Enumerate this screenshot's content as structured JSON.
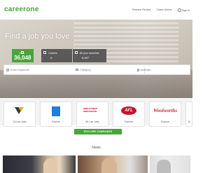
{
  "header": {
    "logo": "careerone",
    "nav": [
      "Resume Review",
      "Career Advice",
      "Sign In"
    ]
  },
  "hero": {
    "title": "Find a job you love",
    "stats": [
      {
        "label": "Jobs",
        "value": "36,048"
      },
      {
        "label": "Careers",
        "value": "5"
      },
      {
        "label": "All your searches",
        "value": "5,467"
      }
    ]
  },
  "search": {
    "keyword_placeholder": "Enter Keywords",
    "category_placeholder": "Category",
    "location_placeholder": "Australia"
  },
  "companies": [
    {
      "label": "24 Live Jobs"
    },
    {
      "label": "Explore"
    },
    {
      "label": "69 Live Jobs",
      "logo_text": "EMPLOYMENT INNOVATIONS"
    },
    {
      "label": "Explore",
      "logo_text": "AFL"
    },
    {
      "label": "Explore",
      "logo_text": "Woolworths"
    },
    {
      "label": "10"
    }
  ],
  "explore_button": "EXPLORE COMPANIES",
  "news": {
    "title": "News"
  },
  "colors": {
    "brand_green": "#4aa33c",
    "company_blue": "#1e7fd8",
    "afl_red": "#c8102e"
  }
}
